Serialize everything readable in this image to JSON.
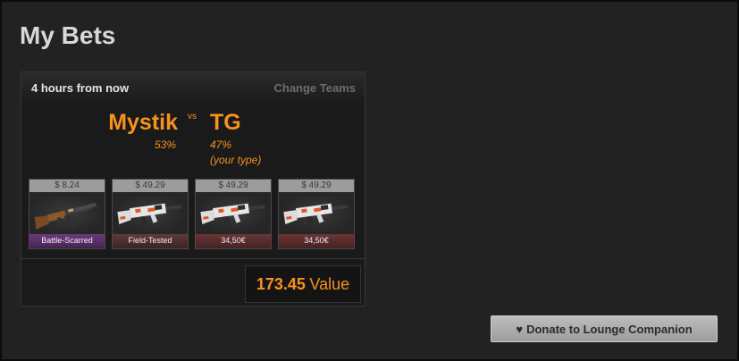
{
  "page": {
    "title": "My Bets"
  },
  "bet": {
    "time": "4 hours from now",
    "change_teams": "Change Teams",
    "team_a": {
      "name": "Mystik",
      "percent": "53%"
    },
    "vs": "vs",
    "team_b": {
      "name": "TG",
      "percent": "47%",
      "note": "(your type)"
    },
    "items": [
      {
        "price": "$ 8.24",
        "condition": "Battle-Scarred",
        "weapon_icon": "ak47-rifle-icon"
      },
      {
        "price": "$ 49.29",
        "condition": "Field-Tested",
        "weapon_icon": "m4-rifle-icon"
      },
      {
        "price": "$ 49.29",
        "condition": "34,50€",
        "weapon_icon": "m4-rifle-icon"
      },
      {
        "price": "$ 49.29",
        "condition": "34,50€",
        "weapon_icon": "m4-rifle-icon"
      }
    ],
    "value_number": "173.45",
    "value_label": "Value"
  },
  "donate": {
    "label": "Donate to Lounge Companion",
    "icon": "heart-icon"
  },
  "colors": {
    "accent": "#f7921e",
    "background": "#222222",
    "battle_scarred": "#5a2e6a",
    "eur_tag": "#5a2c2c"
  }
}
